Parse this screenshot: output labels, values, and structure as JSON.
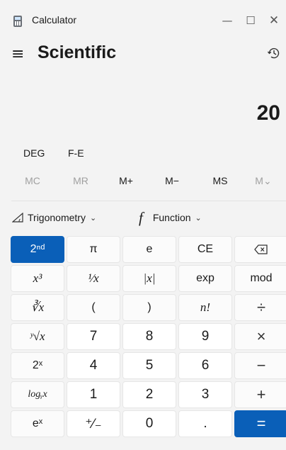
{
  "window": {
    "title": "Calculator",
    "minimize": "—",
    "maximize": "☐",
    "close": "✕"
  },
  "header": {
    "menu_icon": "≡",
    "mode": "Scientific",
    "history_icon": "history-icon"
  },
  "display": {
    "value": "20"
  },
  "angle": {
    "unit": "DEG",
    "notation": "F-E"
  },
  "memory": [
    "MC",
    "MR",
    "M+",
    "M−",
    "MS",
    "M⌄"
  ],
  "functions": {
    "trig_label": "Trigonometry",
    "func_label": "Function",
    "chevron": "⌄",
    "func_symbol": "f"
  },
  "keys": [
    [
      "2ⁿᵈ",
      "π",
      "e",
      "CE",
      "⌫"
    ],
    [
      "x³",
      "¹⁄x",
      "|x|",
      "exp",
      "mod"
    ],
    [
      "∛x",
      "(",
      ")",
      "n!",
      "÷"
    ],
    [
      "ʸ√x",
      "7",
      "8",
      "9",
      "×"
    ],
    [
      "2ˣ",
      "4",
      "5",
      "6",
      "−"
    ],
    [
      "logᵧx",
      "1",
      "2",
      "3",
      "+"
    ],
    [
      "eˣ",
      "⁺⁄₋",
      "0",
      ".",
      "="
    ]
  ],
  "colors": {
    "accent": "#0a5fb8",
    "background": "#f3f3f3"
  }
}
